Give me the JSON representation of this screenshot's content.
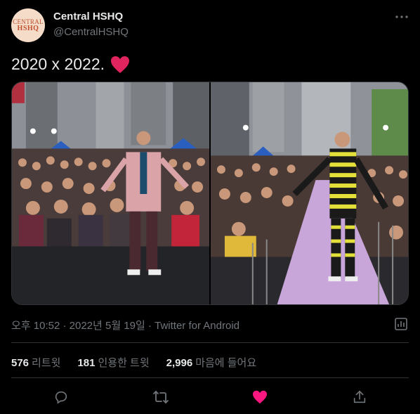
{
  "author": {
    "name": "Central HSHQ",
    "handle": "@CentralHSHQ",
    "avatar_line1": "CENTRAL",
    "avatar_line2": "HSHQ"
  },
  "tweet": {
    "text": "2020 x 2022."
  },
  "meta": {
    "datetime": "오후 10:52 · 2022년 5월 19일 · ",
    "source": "Twitter for Android"
  },
  "stats": {
    "retweets_count": "576",
    "retweets_label": "리트윗",
    "quotes_count": "181",
    "quotes_label": "인용한 트윗",
    "likes_count": "2,996",
    "likes_label": "마음에 들어요"
  },
  "colors": {
    "background": "#000000",
    "text": "#e7e9ea",
    "secondary": "#71767b",
    "border": "#2f3336",
    "like": "#f91880"
  },
  "icons": {
    "more": "more-icon",
    "analytics": "analytics-icon",
    "reply": "reply-icon",
    "retweet": "retweet-icon",
    "like": "heart-icon",
    "share": "share-icon"
  }
}
